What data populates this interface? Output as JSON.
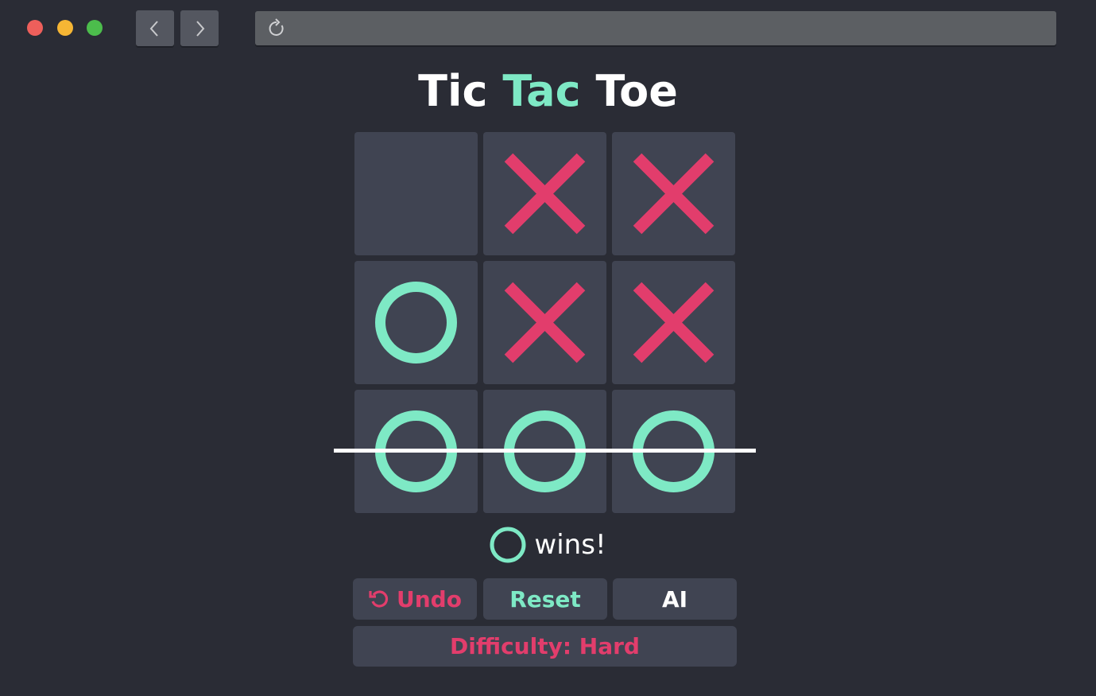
{
  "window": {
    "traffic_lights": [
      "close",
      "minimize",
      "maximize"
    ],
    "back_icon": "chevron-left-icon",
    "forward_icon": "chevron-right-icon",
    "reload_icon": "reload-icon",
    "url": ""
  },
  "game": {
    "title_part1": "Tic",
    "title_part2": "Tac",
    "title_part3": "Toe",
    "board": [
      "",
      "X",
      "X",
      "O",
      "X",
      "X",
      "O",
      "O",
      "O"
    ],
    "winning_line": "bottom-row",
    "status_text": "wins!",
    "winner": "O"
  },
  "controls": {
    "undo_label": "Undo",
    "reset_label": "Reset",
    "ai_label": "AI",
    "difficulty_label": "Difficulty: Hard"
  },
  "colors": {
    "background": "#2a2c35",
    "cell": "#404452",
    "x_color": "#e23d6c",
    "o_color": "#7ee9c5",
    "text": "#ffffff"
  }
}
